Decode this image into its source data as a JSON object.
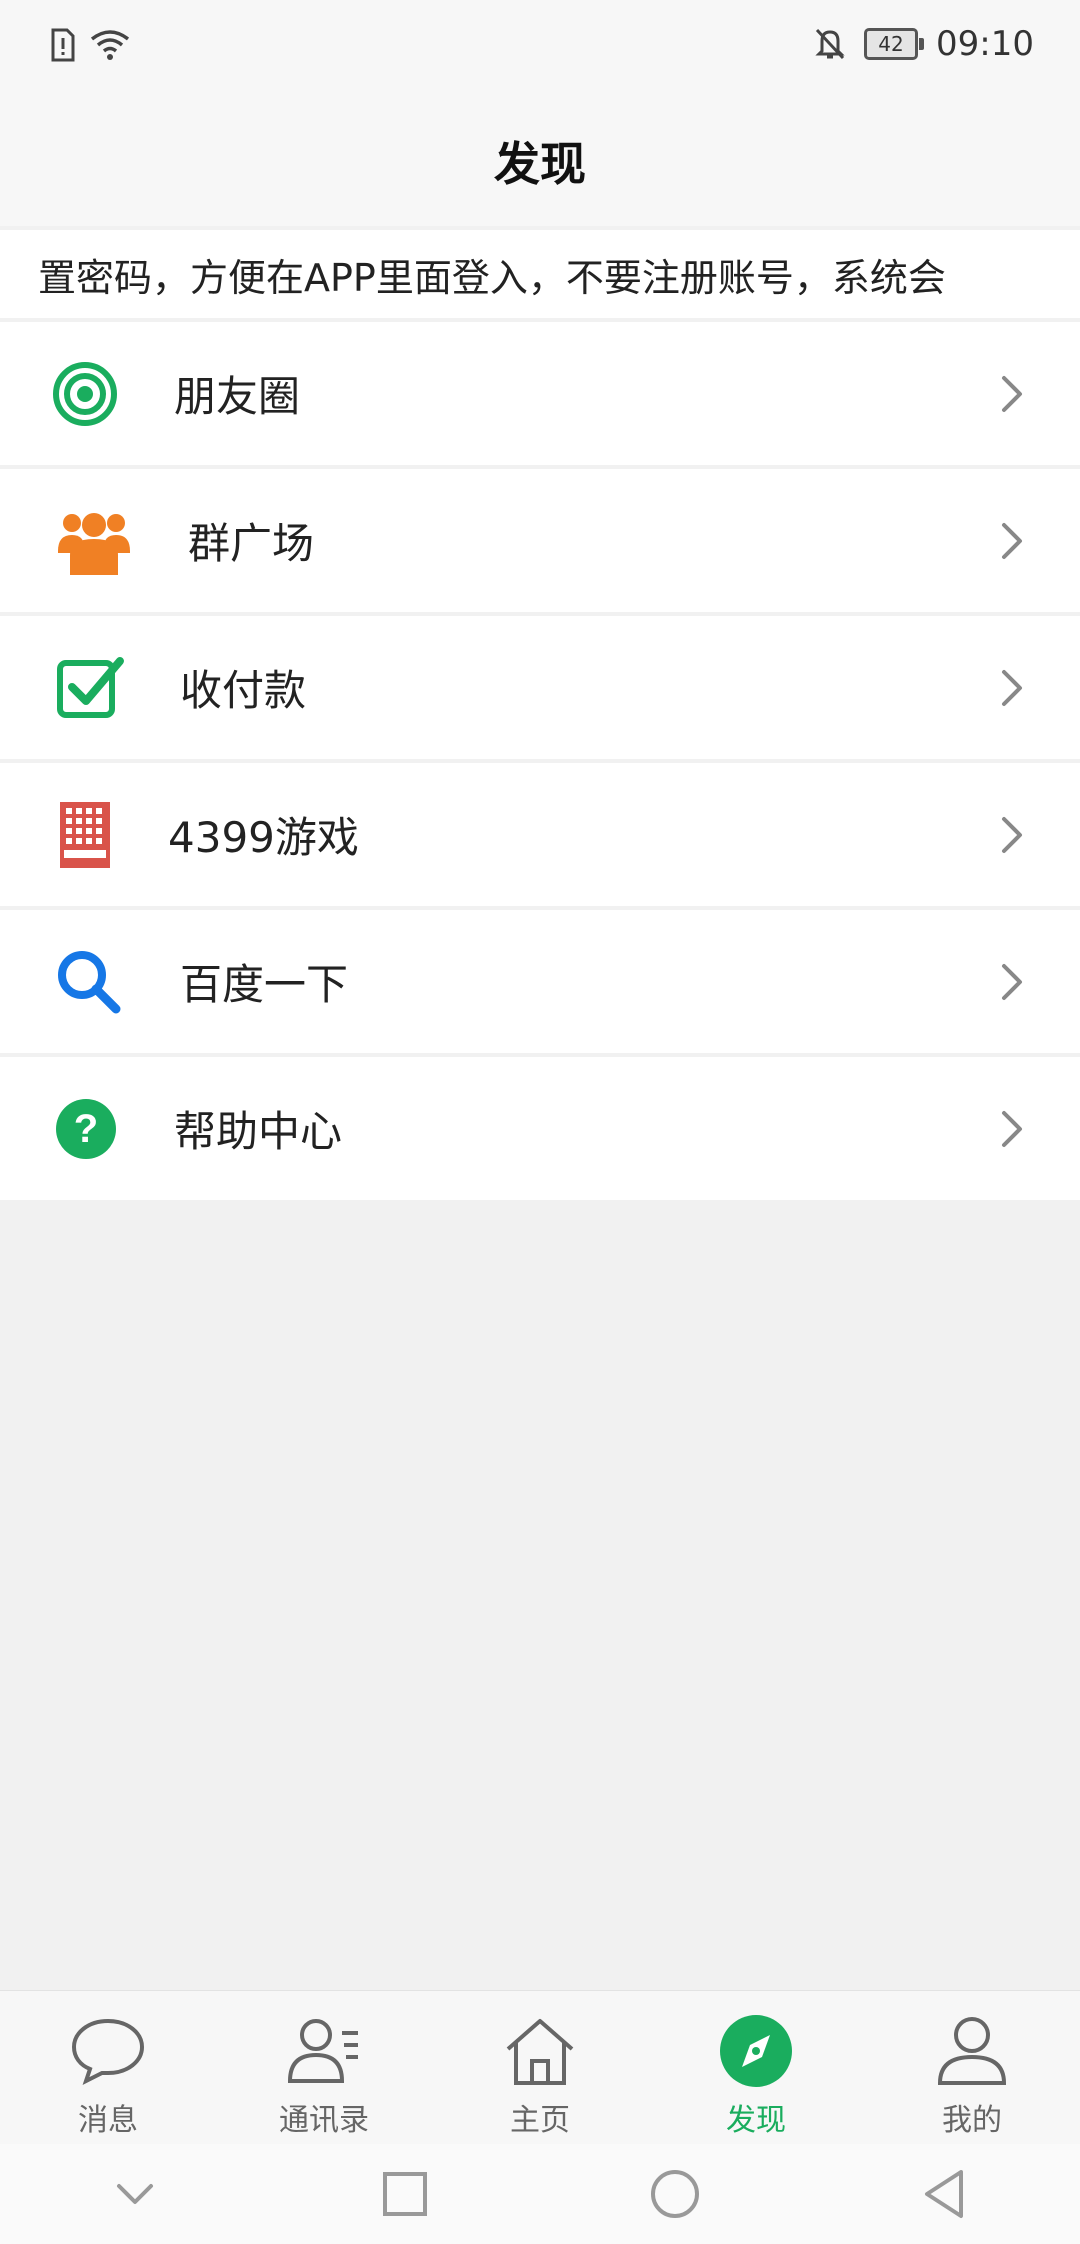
{
  "status_bar": {
    "battery_level": "42",
    "time": "09:10"
  },
  "header": {
    "title": "发现"
  },
  "notice": {
    "text": "置密码，方便在APP里面登入，不要注册账号，系统会"
  },
  "menu": {
    "items": [
      {
        "label": "朋友圈",
        "icon": "moments-icon",
        "color": "#1aad5e"
      },
      {
        "label": "群广场",
        "icon": "group-square-icon",
        "color": "#f08024"
      },
      {
        "label": "收付款",
        "icon": "payment-check-icon",
        "color": "#1aad5e"
      },
      {
        "label": "4399游戏",
        "icon": "building-icon",
        "color": "#d9534a"
      },
      {
        "label": "百度一下",
        "icon": "search-icon",
        "color": "#1677e6"
      },
      {
        "label": "帮助中心",
        "icon": "help-icon",
        "color": "#1aad5e"
      }
    ]
  },
  "tab_bar": {
    "tabs": [
      {
        "label": "消息",
        "icon": "chat-bubble-icon"
      },
      {
        "label": "通讯录",
        "icon": "contacts-icon"
      },
      {
        "label": "主页",
        "icon": "home-icon"
      },
      {
        "label": "发现",
        "icon": "compass-icon",
        "active": true
      },
      {
        "label": "我的",
        "icon": "profile-icon"
      }
    ],
    "active_color": "#1aad5e"
  }
}
